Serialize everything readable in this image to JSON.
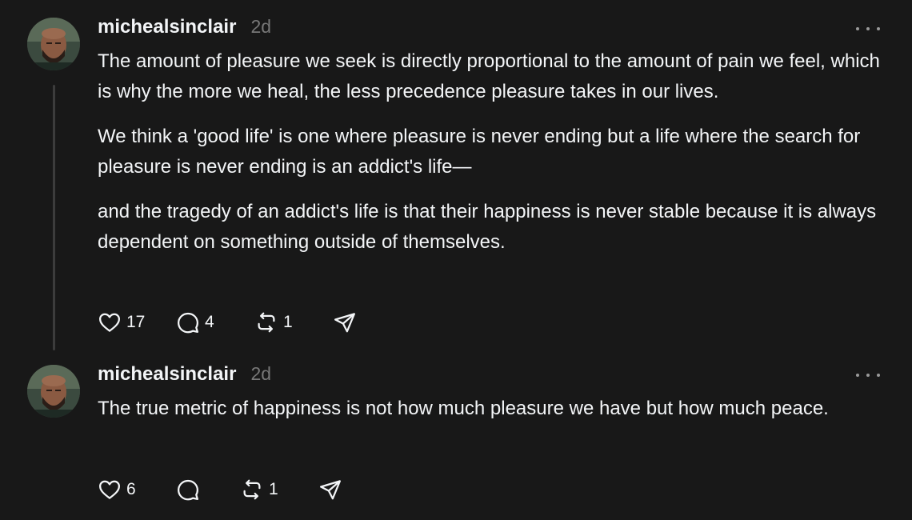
{
  "posts": [
    {
      "username": "michealsinclair",
      "time": "2d",
      "paragraphs": [
        "The amount of pleasure we seek is directly proportional to the amount of pain we feel, which is why the more we heal, the less precedence pleasure takes in our lives.",
        "We think a 'good life' is one where pleasure is never ending but a life where the search for pleasure is never ending is an addict's life—",
        "and the tragedy of an addict's life is that their happiness is never stable because it is always dependent on something outside of themselves."
      ],
      "likes": "17",
      "replies": "4",
      "reposts": "1",
      "icons": [
        "heart-icon",
        "comment-icon",
        "repost-icon",
        "share-icon",
        "more-icon"
      ]
    },
    {
      "username": "michealsinclair",
      "time": "2d",
      "paragraphs": [
        "The true metric of happiness is not how much pleasure we have but how much peace."
      ],
      "likes": "6",
      "replies": "",
      "reposts": "1",
      "icons": [
        "heart-icon",
        "comment-icon",
        "repost-icon",
        "share-icon",
        "more-icon"
      ]
    }
  ],
  "colors": {
    "background": "#181818",
    "text": "#f3f5f7",
    "muted": "#777777",
    "thread_line": "#3c3c3c"
  }
}
